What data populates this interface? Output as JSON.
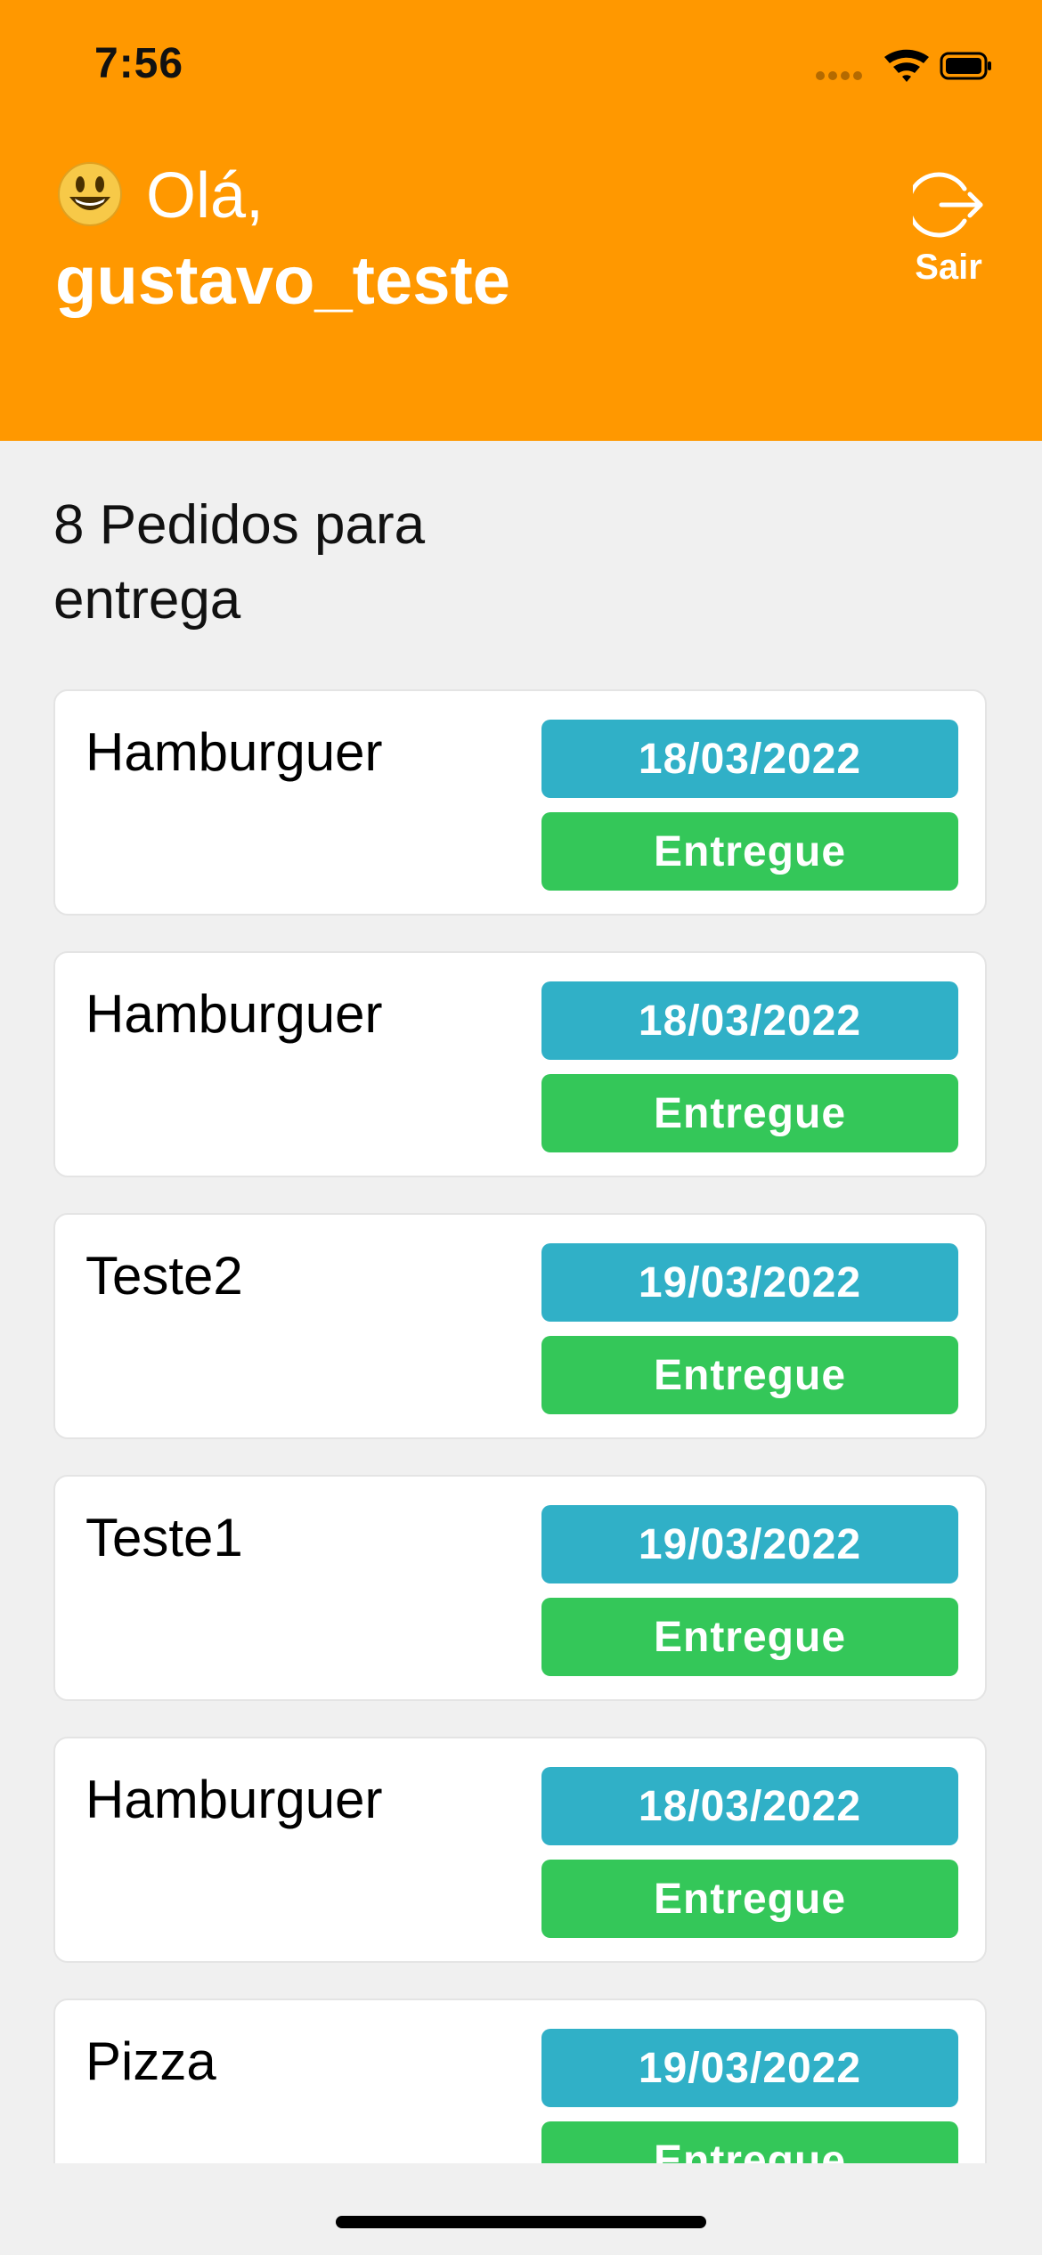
{
  "status_bar": {
    "time": "7:56"
  },
  "header": {
    "greeting": "Olá,",
    "username": "gustavo_teste",
    "logout_label": "Sair"
  },
  "orders": {
    "title": "8 Pedidos para entrega",
    "items": [
      {
        "name": "Hamburguer",
        "date": "18/03/2022",
        "status": "Entregue"
      },
      {
        "name": "Hamburguer",
        "date": "18/03/2022",
        "status": "Entregue"
      },
      {
        "name": "Teste2",
        "date": "19/03/2022",
        "status": "Entregue"
      },
      {
        "name": "Teste1",
        "date": "19/03/2022",
        "status": "Entregue"
      },
      {
        "name": "Hamburguer",
        "date": "18/03/2022",
        "status": "Entregue"
      },
      {
        "name": "Pizza",
        "date": "19/03/2022",
        "status": "Entregue"
      }
    ]
  },
  "colors": {
    "header": "#ff9800",
    "date_badge": "#30b0c7",
    "status_badge": "#34c759",
    "background": "#f0f0f0"
  },
  "icons": {
    "greeting": "smiley-emoji-icon",
    "logout": "logout-icon",
    "signal": "cellular-signal-icon",
    "wifi": "wifi-icon",
    "battery": "battery-icon"
  }
}
